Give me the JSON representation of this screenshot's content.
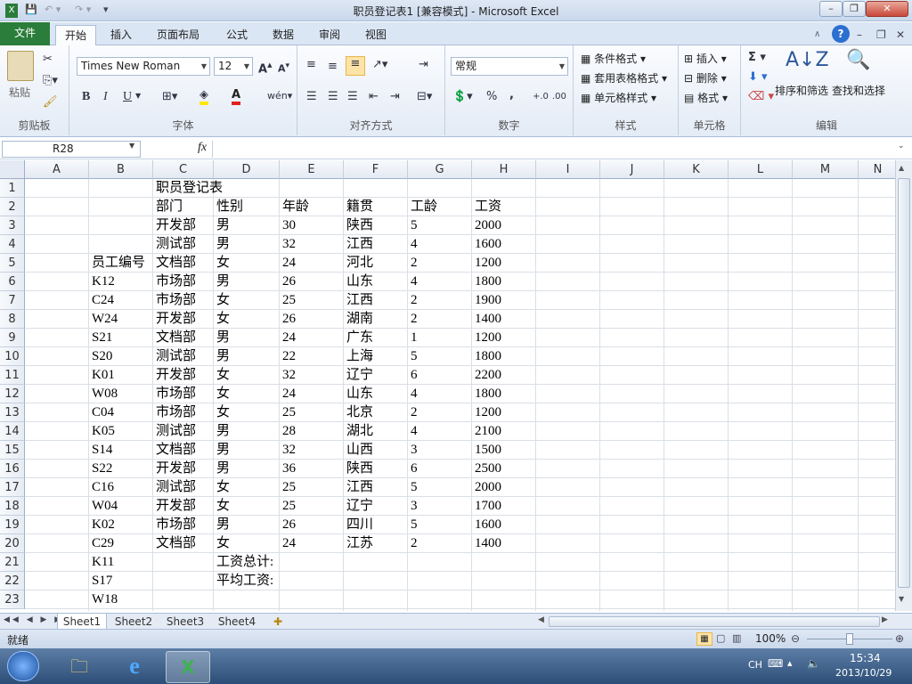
{
  "window": {
    "title": "职员登记表1  [兼容模式]  -  Microsoft Excel",
    "minimize": "–",
    "restore": "❐",
    "close": "✕"
  },
  "tabs": [
    {
      "label": "文件"
    },
    {
      "label": "开始"
    },
    {
      "label": "插入"
    },
    {
      "label": "页面布局"
    },
    {
      "label": "公式"
    },
    {
      "label": "数据"
    },
    {
      "label": "审阅"
    },
    {
      "label": "视图"
    }
  ],
  "ribbon": {
    "clipboard": {
      "group": "剪贴板",
      "paste": "粘贴"
    },
    "font": {
      "group": "字体",
      "name": "Times New Roman",
      "size": "12",
      "bold": "B",
      "italic": "I",
      "underline": "U"
    },
    "alignment": {
      "group": "对齐方式"
    },
    "number": {
      "group": "数字",
      "format": "常规",
      "percent": "%",
      "comma": ","
    },
    "styles": {
      "group": "样式",
      "conditional": "条件格式",
      "table": "套用表格格式",
      "cell": "单元格样式"
    },
    "cells": {
      "group": "单元格",
      "insert": "插入",
      "delete": "删除",
      "format": "格式"
    },
    "editing": {
      "group": "编辑",
      "sort": "排序和筛选",
      "find": "查找和选择"
    }
  },
  "formula_bar": {
    "name_box": "R28",
    "fx": "fx",
    "value": ""
  },
  "grid": {
    "columns": [
      "A",
      "B",
      "C",
      "D",
      "E",
      "F",
      "G",
      "H",
      "I",
      "J",
      "K",
      "L",
      "M",
      "N"
    ],
    "rows": [
      "1",
      "2",
      "3",
      "4",
      "5",
      "6",
      "7",
      "8",
      "9",
      "10",
      "11",
      "12",
      "13",
      "14",
      "15",
      "16",
      "17",
      "18",
      "19",
      "20",
      "21",
      "22",
      "23"
    ],
    "cells": {
      "C1": "职员登记表",
      "C2": "部门",
      "D2": "性别",
      "E2": "年龄",
      "F2": "籍贯",
      "G2": "工龄",
      "H2": "工资",
      "C3": "开发部",
      "D3": "男",
      "E3": "30",
      "F3": "陕西",
      "G3": "5",
      "H3": "2000",
      "C4": "测试部",
      "D4": "男",
      "E4": "32",
      "F4": "江西",
      "G4": "4",
      "H4": "1600",
      "B5": "员工编号",
      "C5": "文档部",
      "D5": "女",
      "E5": "24",
      "F5": "河北",
      "G5": "2",
      "H5": "1200",
      "B6": "K12",
      "C6": "市场部",
      "D6": "男",
      "E6": "26",
      "F6": "山东",
      "G6": "4",
      "H6": "1800",
      "B7": "C24",
      "C7": "市场部",
      "D7": "女",
      "E7": "25",
      "F7": "江西",
      "G7": "2",
      "H7": "1900",
      "B8": "W24",
      "C8": "开发部",
      "D8": "女",
      "E8": "26",
      "F8": "湖南",
      "G8": "2",
      "H8": "1400",
      "B9": "S21",
      "C9": "文档部",
      "D9": "男",
      "E9": "24",
      "F9": "广东",
      "G9": "1",
      "H9": "1200",
      "B10": "S20",
      "C10": "测试部",
      "D10": "男",
      "E10": "22",
      "F10": "上海",
      "G10": "5",
      "H10": "1800",
      "B11": "K01",
      "C11": "开发部",
      "D11": "女",
      "E11": "32",
      "F11": "辽宁",
      "G11": "6",
      "H11": "2200",
      "B12": "W08",
      "C12": "市场部",
      "D12": "女",
      "E12": "24",
      "F12": "山东",
      "G12": "4",
      "H12": "1800",
      "B13": "C04",
      "C13": "市场部",
      "D13": "女",
      "E13": "25",
      "F13": "北京",
      "G13": "2",
      "H13": "1200",
      "B14": "K05",
      "C14": "测试部",
      "D14": "男",
      "E14": "28",
      "F14": "湖北",
      "G14": "4",
      "H14": "2100",
      "B15": "S14",
      "C15": "文档部",
      "D15": "男",
      "E15": "32",
      "F15": "山西",
      "G15": "3",
      "H15": "1500",
      "B16": "S22",
      "C16": "开发部",
      "D16": "男",
      "E16": "36",
      "F16": "陕西",
      "G16": "6",
      "H16": "2500",
      "B17": "C16",
      "C17": "测试部",
      "D17": "女",
      "E17": "25",
      "F17": "江西",
      "G17": "5",
      "H17": "2000",
      "B18": "W04",
      "C18": "开发部",
      "D18": "女",
      "E18": "25",
      "F18": "辽宁",
      "G18": "3",
      "H18": "1700",
      "B19": "K02",
      "C19": "市场部",
      "D19": "男",
      "E19": "26",
      "F19": "四川",
      "G19": "5",
      "H19": "1600",
      "B20": "C29",
      "C20": "文档部",
      "D20": "女",
      "E20": "24",
      "F20": "江苏",
      "G20": "2",
      "H20": "1400",
      "B21": "K11",
      "D21": "工资总计:",
      "B22": "S17",
      "D22": "平均工资:",
      "B23": "W18"
    }
  },
  "sheets": [
    {
      "label": "Sheet1",
      "active": true
    },
    {
      "label": "Sheet2",
      "active": false
    },
    {
      "label": "Sheet3",
      "active": false
    },
    {
      "label": "Sheet4",
      "active": false
    }
  ],
  "status": {
    "ready": "就绪",
    "zoom": "100%"
  },
  "taskbar": {
    "lang": "CH",
    "time": "15:34",
    "date": "2013/10/29"
  },
  "colors": {
    "file_tab": "#2a7d3a",
    "accent": "#2b579a"
  }
}
